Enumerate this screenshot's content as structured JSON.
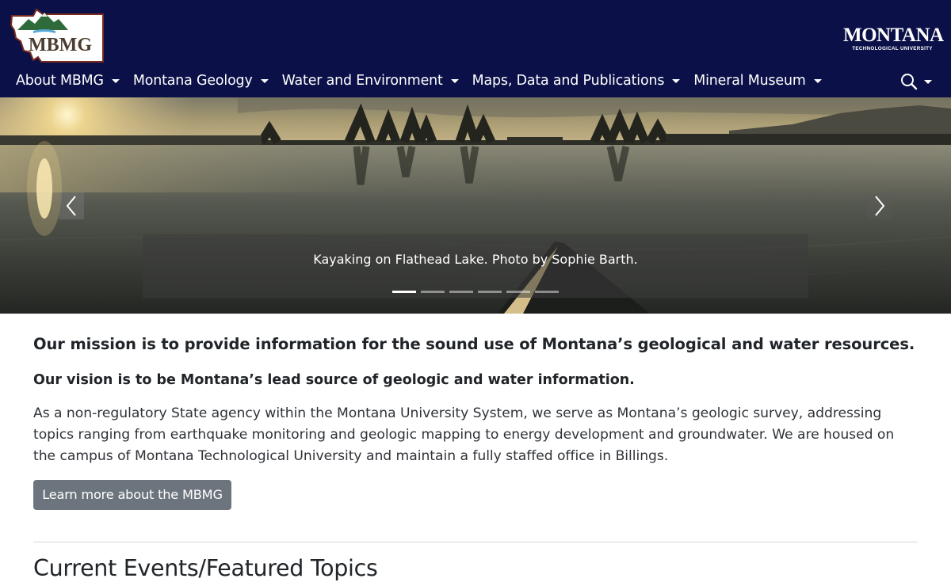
{
  "header": {
    "logo_text": "MBMG",
    "brand_primary": "#0b1148",
    "partner_logo": {
      "word": "MONTANA",
      "subtitle": "TECHNOLOGICAL UNIVERSITY"
    }
  },
  "nav": {
    "items": [
      {
        "label": "About MBMG"
      },
      {
        "label": "Montana Geology"
      },
      {
        "label": "Water and Environment"
      },
      {
        "label": "Maps, Data and Publications"
      },
      {
        "label": "Mineral Museum"
      }
    ],
    "search_icon": "search-icon"
  },
  "carousel": {
    "caption": "Kayaking on Flathead Lake. Photo by Sophie Barth.",
    "slide_count": 6,
    "active_slide": 1,
    "prev_icon": "chevron-left-icon",
    "next_icon": "chevron-right-icon"
  },
  "main": {
    "mission": "Our mission is to provide information for the sound use of Montana’s geological and water resources.",
    "vision": "Our vision is to be Montana’s lead source of geologic and water information.",
    "about": "As a non-regulatory State agency within the Montana University System, we serve as Montana’s geologic survey, addressing topics ranging from earthquake monitoring and geologic mapping to energy development and groundwater. We are housed on the campus of Montana Technological University and maintain a fully staffed office in Billings.",
    "learn_more_label": "Learn more about the MBMG",
    "button_color": "#6c757d",
    "section_title": "Current Events/Featured Topics"
  }
}
